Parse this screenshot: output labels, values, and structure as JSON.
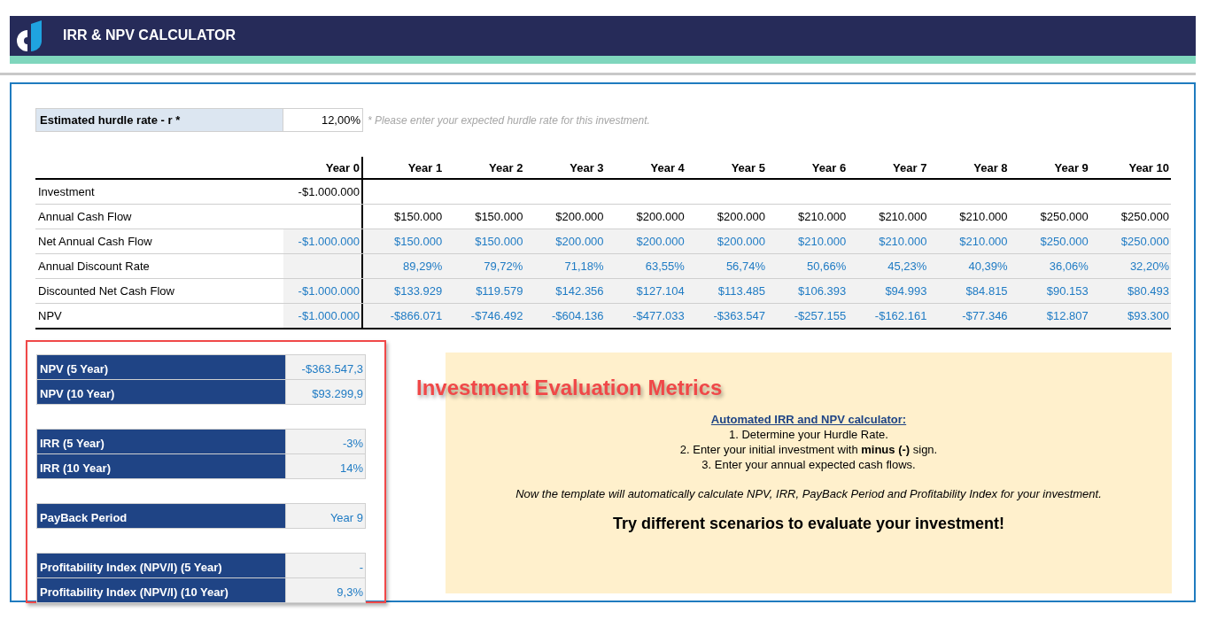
{
  "header": {
    "title": "IRR & NPV CALCULATOR"
  },
  "hurdle": {
    "label": "Estimated hurdle rate - r *",
    "value": "12,00%",
    "note": "* Please enter your expected hurdle rate for this investment."
  },
  "table": {
    "columns": [
      "Year 0",
      "Year 1",
      "Year 2",
      "Year 3",
      "Year 4",
      "Year 5",
      "Year 6",
      "Year 7",
      "Year 8",
      "Year 9",
      "Year 10"
    ],
    "rows": [
      {
        "label": "Investment",
        "kind": "input",
        "cells": [
          "-$1.000.000",
          null,
          null,
          null,
          null,
          null,
          null,
          null,
          null,
          null,
          null
        ]
      },
      {
        "label": "Annual Cash Flow",
        "kind": "input",
        "cells": [
          null,
          "$150.000",
          "$150.000",
          "$200.000",
          "$200.000",
          "$200.000",
          "$210.000",
          "$210.000",
          "$210.000",
          "$250.000",
          "$250.000"
        ]
      },
      {
        "label": "Net Annual Cash Flow",
        "kind": "computed",
        "cells": [
          "-$1.000.000",
          "$150.000",
          "$150.000",
          "$200.000",
          "$200.000",
          "$200.000",
          "$210.000",
          "$210.000",
          "$210.000",
          "$250.000",
          "$250.000"
        ]
      },
      {
        "label": "Annual Discount Rate",
        "kind": "computed",
        "cells": [
          null,
          "89,29%",
          "79,72%",
          "71,18%",
          "63,55%",
          "56,74%",
          "50,66%",
          "45,23%",
          "40,39%",
          "36,06%",
          "32,20%"
        ]
      },
      {
        "label": "Discounted Net Cash Flow",
        "kind": "computed",
        "cells": [
          "-$1.000.000",
          "$133.929",
          "$119.579",
          "$142.356",
          "$127.104",
          "$113.485",
          "$106.393",
          "$94.993",
          "$84.815",
          "$90.153",
          "$80.493"
        ]
      },
      {
        "label": "NPV",
        "kind": "computed",
        "cells": [
          "-$1.000.000",
          "-$866.071",
          "-$746.492",
          "-$604.136",
          "-$477.033",
          "-$363.547",
          "-$257.155",
          "-$162.161",
          "-$77.346",
          "$12.807",
          "$93.300"
        ]
      }
    ]
  },
  "metrics": {
    "groups": [
      {
        "items": [
          {
            "label": "NPV (5 Year)",
            "value": "-$363.547,3"
          },
          {
            "label": "NPV (10 Year)",
            "value": "$93.299,9"
          }
        ]
      },
      {
        "items": [
          {
            "label": "IRR (5 Year)",
            "value": "-3%"
          },
          {
            "label": "IRR (10 Year)",
            "value": "14%"
          }
        ]
      },
      {
        "items": [
          {
            "label": "PayBack Period",
            "value": "Year 9"
          }
        ]
      },
      {
        "items": [
          {
            "label": "Profitability Index (NPV/I) (5 Year)",
            "value": "-"
          },
          {
            "label": "Profitability Index (NPV/I) (10 Year)",
            "value": "9,3%"
          }
        ]
      }
    ]
  },
  "callout": {
    "title": "Investment Evaluation Metrics"
  },
  "instructions": {
    "heading": "Automated IRR and NPV calculator:",
    "steps": [
      "1. Determine your Hurdle Rate.",
      "2. Enter your initial investment with **minus (-)** sign.",
      "3. Enter your annual expected cash flows."
    ],
    "note": "Now the template will automatically calculate NPV, IRR, PayBack Period and Profitability Index for your investment.",
    "cta": "Try different scenarios to evaluate your investment!"
  }
}
